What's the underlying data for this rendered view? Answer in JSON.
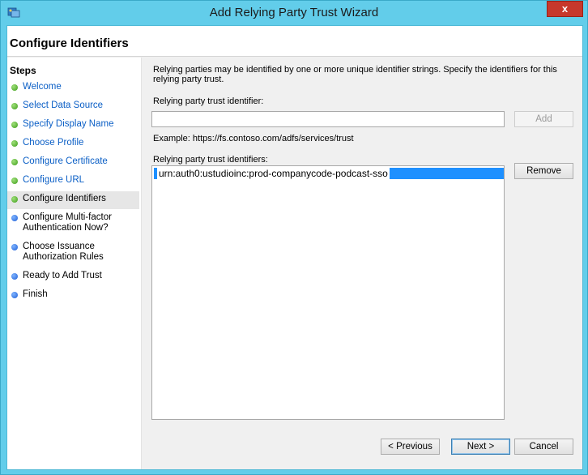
{
  "window": {
    "title": "Add Relying Party Trust Wizard",
    "close_label": "x"
  },
  "header": {
    "title": "Configure Identifiers"
  },
  "sidebar": {
    "title": "Steps",
    "items": [
      {
        "label": "Welcome",
        "status": "done"
      },
      {
        "label": "Select Data Source",
        "status": "done"
      },
      {
        "label": "Specify Display Name",
        "status": "done"
      },
      {
        "label": "Choose Profile",
        "status": "done"
      },
      {
        "label": "Configure Certificate",
        "status": "done"
      },
      {
        "label": "Configure URL",
        "status": "done"
      },
      {
        "label": "Configure Identifiers",
        "status": "current"
      },
      {
        "label": "Configure Multi-factor Authentication Now?",
        "status": "pending"
      },
      {
        "label": "Choose Issuance Authorization Rules",
        "status": "pending"
      },
      {
        "label": "Ready to Add Trust",
        "status": "pending"
      },
      {
        "label": "Finish",
        "status": "pending"
      }
    ]
  },
  "main": {
    "description": "Relying parties may be identified by one or more unique identifier strings. Specify the identifiers for this relying party trust.",
    "identifier_label": "Relying party trust identifier:",
    "identifier_value": "",
    "add_label": "Add",
    "example": "Example: https://fs.contoso.com/adfs/services/trust",
    "list_label": "Relying party trust identifiers:",
    "identifiers": [
      "urn:auth0:ustudioinc:prod-companycode-podcast-sso"
    ],
    "remove_label": "Remove"
  },
  "footer": {
    "previous_label": "< Previous",
    "next_label": "Next >",
    "cancel_label": "Cancel"
  },
  "colors": {
    "titlebar": "#62cdea",
    "close": "#c7382c",
    "link": "#0b5fc6",
    "selection": "#1e90ff"
  }
}
